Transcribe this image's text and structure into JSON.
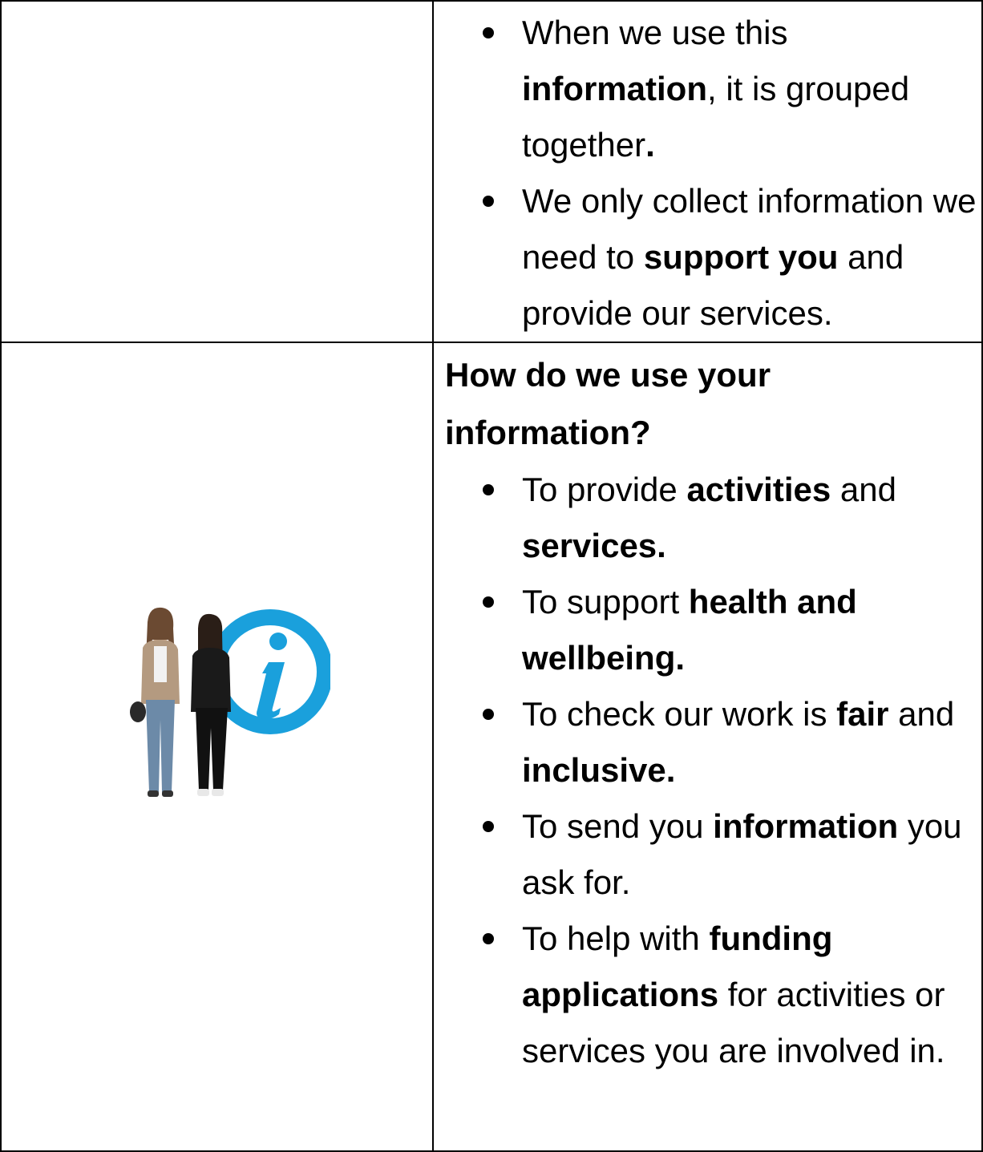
{
  "top_bullets": [
    {
      "segments": [
        {
          "text": "When we use this ",
          "bold": false
        },
        {
          "text": "information",
          "bold": true
        },
        {
          "text": ", it is grouped together",
          "bold": false
        },
        {
          "text": ".",
          "bold": true
        }
      ]
    },
    {
      "segments": [
        {
          "text": "We only collect information we need to ",
          "bold": false
        },
        {
          "text": "support you",
          "bold": true
        },
        {
          "text": " and provide our services.",
          "bold": false
        }
      ]
    }
  ],
  "section": {
    "title": "How do we use your information?",
    "bullets": [
      {
        "segments": [
          {
            "text": "To provide ",
            "bold": false
          },
          {
            "text": "activities",
            "bold": true
          },
          {
            "text": " and ",
            "bold": false
          },
          {
            "text": "services.",
            "bold": true
          }
        ]
      },
      {
        "segments": [
          {
            "text": "To support ",
            "bold": false
          },
          {
            "text": "health and wellbeing.",
            "bold": true
          }
        ]
      },
      {
        "segments": [
          {
            "text": "To check our work is ",
            "bold": false
          },
          {
            "text": "fair",
            "bold": true
          },
          {
            "text": " and ",
            "bold": false
          },
          {
            "text": "inclusive.",
            "bold": true
          }
        ]
      },
      {
        "segments": [
          {
            "text": "To send you ",
            "bold": false
          },
          {
            "text": "information",
            "bold": true
          },
          {
            "text": " you ask for.",
            "bold": false
          }
        ]
      },
      {
        "segments": [
          {
            "text": "To help with ",
            "bold": false
          },
          {
            "text": "funding applications",
            "bold": true
          },
          {
            "text": " for activities or services you are involved in.",
            "bold": false
          }
        ]
      }
    ]
  },
  "illustration": {
    "icon": "info-icon",
    "accent_color": "#1aa0dc"
  }
}
